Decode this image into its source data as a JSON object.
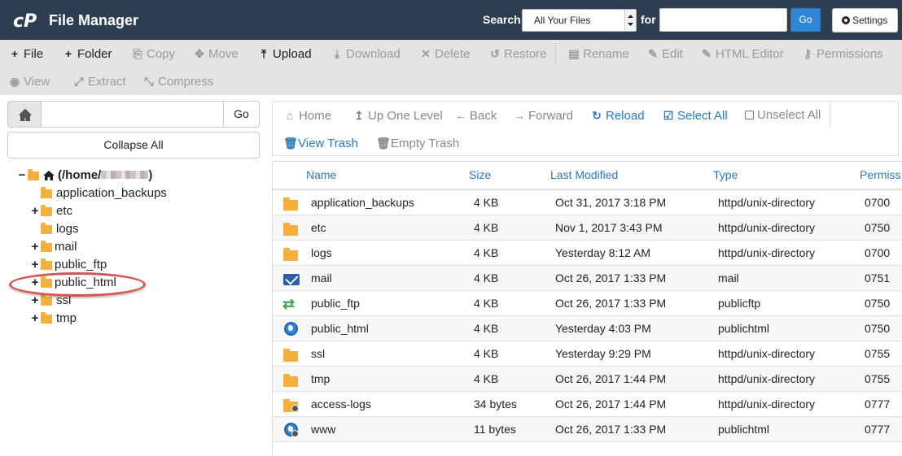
{
  "header": {
    "app_title": "File Manager",
    "search_label": "Search",
    "search_scope": "All Your Files",
    "for_label": "for",
    "search_value": "",
    "go_label": "Go",
    "settings_label": "Settings",
    "background_color": "#2d3e50",
    "accent_color": "#2f86d6"
  },
  "toolbar": {
    "file": "File",
    "folder": "Folder",
    "copy": "Copy",
    "move": "Move",
    "upload": "Upload",
    "download": "Download",
    "delete": "Delete",
    "restore": "Restore",
    "rename": "Rename",
    "edit": "Edit",
    "html_editor": "HTML Editor",
    "permissions": "Permissions",
    "view": "View",
    "extract": "Extract",
    "compress": "Compress"
  },
  "sidebar": {
    "path_value": "",
    "go_label": "Go",
    "collapse_label": "Collapse All",
    "root_label": "(/home/",
    "root_suffix": ")",
    "tree": [
      {
        "label": "application_backups",
        "expandable": false
      },
      {
        "label": "etc",
        "expandable": true
      },
      {
        "label": "logs",
        "expandable": false
      },
      {
        "label": "mail",
        "expandable": true
      },
      {
        "label": "public_ftp",
        "expandable": true
      },
      {
        "label": "public_html",
        "expandable": true,
        "highlighted": true
      },
      {
        "label": "ssl",
        "expandable": true
      },
      {
        "label": "tmp",
        "expandable": true
      }
    ]
  },
  "nav": {
    "home": "Home",
    "up_one_level": "Up One Level",
    "back": "Back",
    "forward": "Forward",
    "reload": "Reload",
    "select_all": "Select All",
    "unselect_all": "Unselect All",
    "view_trash": "View Trash",
    "empty_trash": "Empty Trash"
  },
  "table": {
    "columns": [
      "Name",
      "Size",
      "Last Modified",
      "Type",
      "Permiss"
    ],
    "rows": [
      {
        "icon": "folder-icon",
        "name": "application_backups",
        "size": "4 KB",
        "modified": "Oct 31, 2017 3:18 PM",
        "type": "httpd/unix-directory",
        "perms": "0700"
      },
      {
        "icon": "folder-icon",
        "name": "etc",
        "size": "4 KB",
        "modified": "Nov 1, 2017 3:43 PM",
        "type": "httpd/unix-directory",
        "perms": "0750"
      },
      {
        "icon": "folder-icon",
        "name": "logs",
        "size": "4 KB",
        "modified": "Yesterday 8:12 AM",
        "type": "httpd/unix-directory",
        "perms": "0700"
      },
      {
        "icon": "mail-icon",
        "name": "mail",
        "size": "4 KB",
        "modified": "Oct 26, 2017 1:33 PM",
        "type": "mail",
        "perms": "0751"
      },
      {
        "icon": "transfer-icon",
        "name": "public_ftp",
        "size": "4 KB",
        "modified": "Oct 26, 2017 1:33 PM",
        "type": "publicftp",
        "perms": "0750"
      },
      {
        "icon": "globe-icon",
        "name": "public_html",
        "size": "4 KB",
        "modified": "Yesterday 4:03 PM",
        "type": "publichtml",
        "perms": "0750"
      },
      {
        "icon": "folder-icon",
        "name": "ssl",
        "size": "4 KB",
        "modified": "Yesterday 9:29 PM",
        "type": "httpd/unix-directory",
        "perms": "0755"
      },
      {
        "icon": "folder-icon",
        "name": "tmp",
        "size": "4 KB",
        "modified": "Oct 26, 2017 1:44 PM",
        "type": "httpd/unix-directory",
        "perms": "0755"
      },
      {
        "icon": "folder-link-icon",
        "name": "access-logs",
        "size": "34 bytes",
        "modified": "Oct 26, 2017 1:44 PM",
        "type": "httpd/unix-directory",
        "perms": "0777"
      },
      {
        "icon": "globe-link-icon",
        "name": "www",
        "size": "11 bytes",
        "modified": "Oct 26, 2017 1:33 PM",
        "type": "publichtml",
        "perms": "0777"
      }
    ]
  }
}
